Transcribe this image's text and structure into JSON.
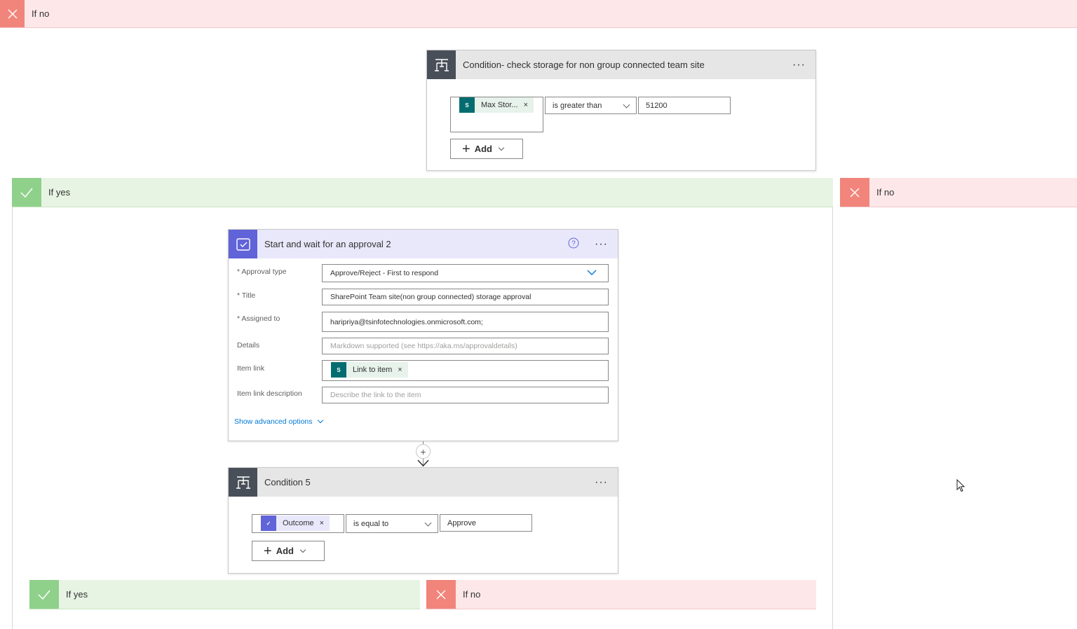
{
  "branches": {
    "top_no": "If no",
    "outer_yes": "If yes",
    "outer_no": "If no",
    "inner_yes": "If yes",
    "inner_no": "If no"
  },
  "condition1": {
    "title": "Condition- check storage for non group connected team site",
    "token": "Max Stor...",
    "operator": "is greater than",
    "value": "51200",
    "add_label": "Add"
  },
  "approval": {
    "title": "Start and wait for an approval 2",
    "fields": {
      "approval_type_label": "* Approval type",
      "approval_type_value": "Approve/Reject - First to respond",
      "title_label": "* Title",
      "title_value": "SharePoint Team site(non group connected) storage approval",
      "assigned_label": "* Assigned to",
      "assigned_value": "haripriya@tsinfotechnologies.onmicrosoft.com;",
      "details_label": "Details",
      "details_placeholder": "Markdown supported (see https://aka.ms/approvaldetails)",
      "item_link_label": "Item link",
      "item_link_token": "Link to item",
      "item_link_desc_label": "Item link description",
      "item_link_desc_placeholder": "Describe the link to the item"
    },
    "advanced": "Show advanced options"
  },
  "condition5": {
    "title": "Condition 5",
    "token": "Outcome",
    "operator": "is equal to",
    "value": "Approve",
    "add_label": "Add"
  },
  "icons": {
    "close": "close-icon",
    "check": "check-icon",
    "condition": "condition-icon",
    "approval": "approval-icon",
    "sharepoint": "sharepoint-icon",
    "help": "help-icon",
    "more": "more-icon",
    "insert": "insert-step-icon",
    "cursor": "mouse-cursor-icon"
  },
  "colors": {
    "no_bg": "#fde7e9",
    "no_icon": "#f1857b",
    "yes_bg": "#e7f4e4",
    "yes_icon": "#8fd18b",
    "condition_icon": "#484f58",
    "approval_icon": "#6163d8",
    "sharepoint": "#036c70",
    "link": "#0078d4"
  }
}
